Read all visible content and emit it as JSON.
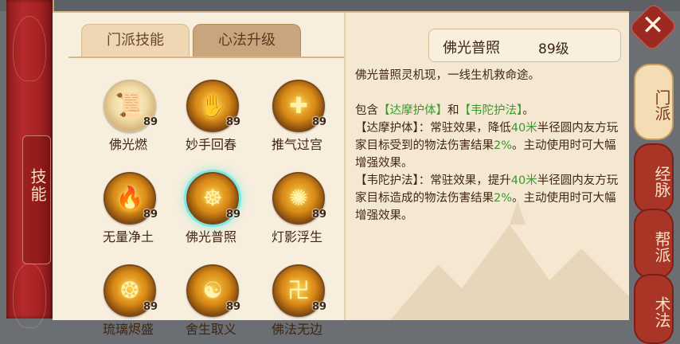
{
  "left_tab": {
    "label": "技能"
  },
  "tabs": [
    {
      "label": "门派技能",
      "active": true
    },
    {
      "label": "心法升级",
      "active": false
    }
  ],
  "skills": [
    {
      "name": "佛光燃",
      "level": "89",
      "icon": "scroll-icon",
      "glyph": "📜"
    },
    {
      "name": "妙手回春",
      "level": "89",
      "icon": "hand-flame-icon",
      "glyph": "✋"
    },
    {
      "name": "推气过宫",
      "level": "89",
      "icon": "healing-cross-icon",
      "glyph": "✚"
    },
    {
      "name": "无量净土",
      "level": "89",
      "icon": "flame-icon",
      "glyph": "🔥"
    },
    {
      "name": "佛光普照",
      "level": "89",
      "icon": "buddha-icon",
      "glyph": "☸"
    },
    {
      "name": "灯影浮生",
      "level": "89",
      "icon": "lamp-flame-icon",
      "glyph": "✺"
    },
    {
      "name": "琉璃烬盛",
      "level": "89",
      "icon": "swirl-icon",
      "glyph": "❂"
    },
    {
      "name": "舍生取义",
      "level": "89",
      "icon": "monk-icon",
      "glyph": "☯"
    },
    {
      "name": "佛法无边",
      "level": "89",
      "icon": "scripture-icon",
      "glyph": "卍"
    }
  ],
  "selected_skill_index": 4,
  "detail": {
    "title": "佛光普照",
    "level": "89级",
    "intro": "佛光普照灵机现，一线生机救命途。",
    "contains_prefix": "包含",
    "contains_a": "【达摩护体】",
    "contains_and": "和",
    "contains_b": "【韦陀护法】",
    "contains_suffix": "。",
    "p1_label": "【达摩护体】",
    "p1_a": "：常驻效果，降低",
    "p1_dist": "40米",
    "p1_b": "半径圆内友方玩家目标受到的物法伤害结果",
    "p1_pct": "2%",
    "p1_c": "。主动使用时可大幅增强效果。",
    "p2_label": "【韦陀护法】",
    "p2_a": "：常驻效果，提升",
    "p2_dist": "40米",
    "p2_b": "半径圆内友方玩家目标造成的物法伤害结果",
    "p2_pct": "2%",
    "p2_c": "。主动使用时可大幅增强效果。"
  },
  "side_tabs": [
    {
      "label": "门派",
      "active": true
    },
    {
      "label": "经脉",
      "active": false
    },
    {
      "label": "帮派",
      "active": false
    },
    {
      "label": "术法",
      "active": false
    }
  ],
  "close_label": "✕",
  "colors": {
    "accent_green": "#3a9a2c",
    "binder_red": "#a72424",
    "parchment": "#f6ead6"
  }
}
